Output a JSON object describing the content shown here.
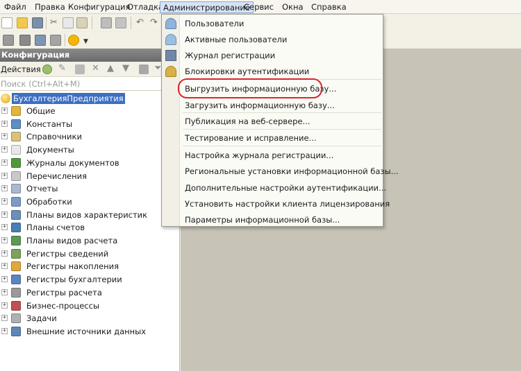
{
  "menubar": {
    "items": [
      "Файл",
      "Правка",
      "Конфигурация",
      "Отладка",
      "Администрирование",
      "Сервис",
      "Окна",
      "Справка"
    ],
    "active": "Администрирование"
  },
  "panel": {
    "title": "Конфигурация",
    "actions_label": "Действия",
    "search_placeholder": "Поиск (Ctrl+Alt+M)"
  },
  "tree": {
    "root": "БухгалтерияПредприятия",
    "items": [
      {
        "label": "Общие",
        "icon": "common-icon"
      },
      {
        "label": "Константы",
        "icon": "constants-icon"
      },
      {
        "label": "Справочники",
        "icon": "catalogs-icon"
      },
      {
        "label": "Документы",
        "icon": "documents-icon"
      },
      {
        "label": "Журналы документов",
        "icon": "document-journals-icon"
      },
      {
        "label": "Перечисления",
        "icon": "enumerations-icon"
      },
      {
        "label": "Отчеты",
        "icon": "reports-icon"
      },
      {
        "label": "Обработки",
        "icon": "data-processors-icon"
      },
      {
        "label": "Планы видов характеристик",
        "icon": "characteristic-types-icon"
      },
      {
        "label": "Планы счетов",
        "icon": "chart-of-accounts-icon"
      },
      {
        "label": "Планы видов расчета",
        "icon": "calculation-types-icon"
      },
      {
        "label": "Регистры сведений",
        "icon": "information-registers-icon"
      },
      {
        "label": "Регистры накопления",
        "icon": "accumulation-registers-icon"
      },
      {
        "label": "Регистры бухгалтерии",
        "icon": "accounting-registers-icon"
      },
      {
        "label": "Регистры расчета",
        "icon": "calculation-registers-icon"
      },
      {
        "label": "Бизнес-процессы",
        "icon": "business-processes-icon"
      },
      {
        "label": "Задачи",
        "icon": "tasks-icon"
      },
      {
        "label": "Внешние источники данных",
        "icon": "external-data-sources-icon"
      }
    ]
  },
  "dropdown": {
    "items": [
      {
        "label": "Пользователи",
        "icon": "users-icon"
      },
      {
        "label": "Активные пользователи",
        "icon": "active-users-icon"
      },
      {
        "label": "Журнал регистрации",
        "icon": "event-log-icon"
      },
      {
        "label": "Блокировки аутентификации",
        "icon": "auth-lock-icon"
      },
      {
        "label": "Выгрузить информационную базу...",
        "icon": ""
      },
      {
        "label": "Загрузить информационную базу...",
        "icon": ""
      },
      {
        "label": "Публикация на веб-сервере...",
        "icon": ""
      },
      {
        "label": "Тестирование и исправление...",
        "icon": ""
      },
      {
        "label": "Настройка журнала регистрации...",
        "icon": ""
      },
      {
        "label": "Региональные установки информационной базы...",
        "icon": ""
      },
      {
        "label": "Дополнительные настройки аутентификации...",
        "icon": ""
      },
      {
        "label": "Установить настройки клиента лицензирования",
        "icon": ""
      },
      {
        "label": "Параметры информационной базы...",
        "icon": ""
      }
    ],
    "highlighted": "Выгрузить информационную базу..."
  },
  "colors": {
    "highlight_ring": "#d9262b",
    "selection": "#3c6fc1",
    "panel_header": "#7a7a7a",
    "workspace": "#c7c3b7"
  }
}
